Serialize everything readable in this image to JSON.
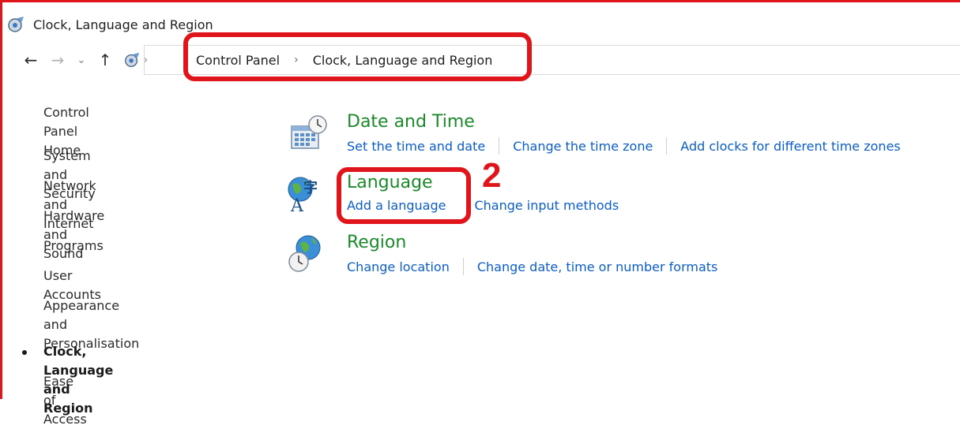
{
  "window": {
    "title": "Clock, Language and Region"
  },
  "nav": {
    "back": "←",
    "forward": "→",
    "recent": "⌄",
    "up": "↑",
    "path_separator": "›"
  },
  "breadcrumb": {
    "items": [
      "Control Panel",
      "Clock, Language and Region"
    ],
    "separator": "›"
  },
  "sidebar": {
    "items": [
      {
        "label": "Control Panel Home"
      },
      {
        "label": "System and Security"
      },
      {
        "label": "Network and Internet"
      },
      {
        "label": "Hardware and Sound"
      },
      {
        "label": "Programs"
      },
      {
        "label": "User Accounts"
      },
      {
        "label": "Appearance and\nPersonalisation"
      },
      {
        "label": "Clock, Language and Region",
        "current": true
      },
      {
        "label": "Ease of Access"
      }
    ]
  },
  "categories": [
    {
      "title": "Date and Time",
      "icon": "calendar-clock-icon",
      "links": [
        "Set the time and date",
        "Change the time zone",
        "Add clocks for different time zones"
      ]
    },
    {
      "title": "Language",
      "icon": "language-globe-icon",
      "links": [
        "Add a language",
        "Change input methods"
      ]
    },
    {
      "title": "Region",
      "icon": "globe-clock-icon",
      "links": [
        "Change location",
        "Change date, time or number formats"
      ]
    }
  ],
  "annotation": {
    "step": "2"
  },
  "colors": {
    "category_title": "#1a8a2a",
    "link": "#0c5ec7",
    "highlight": "#e0151b"
  }
}
